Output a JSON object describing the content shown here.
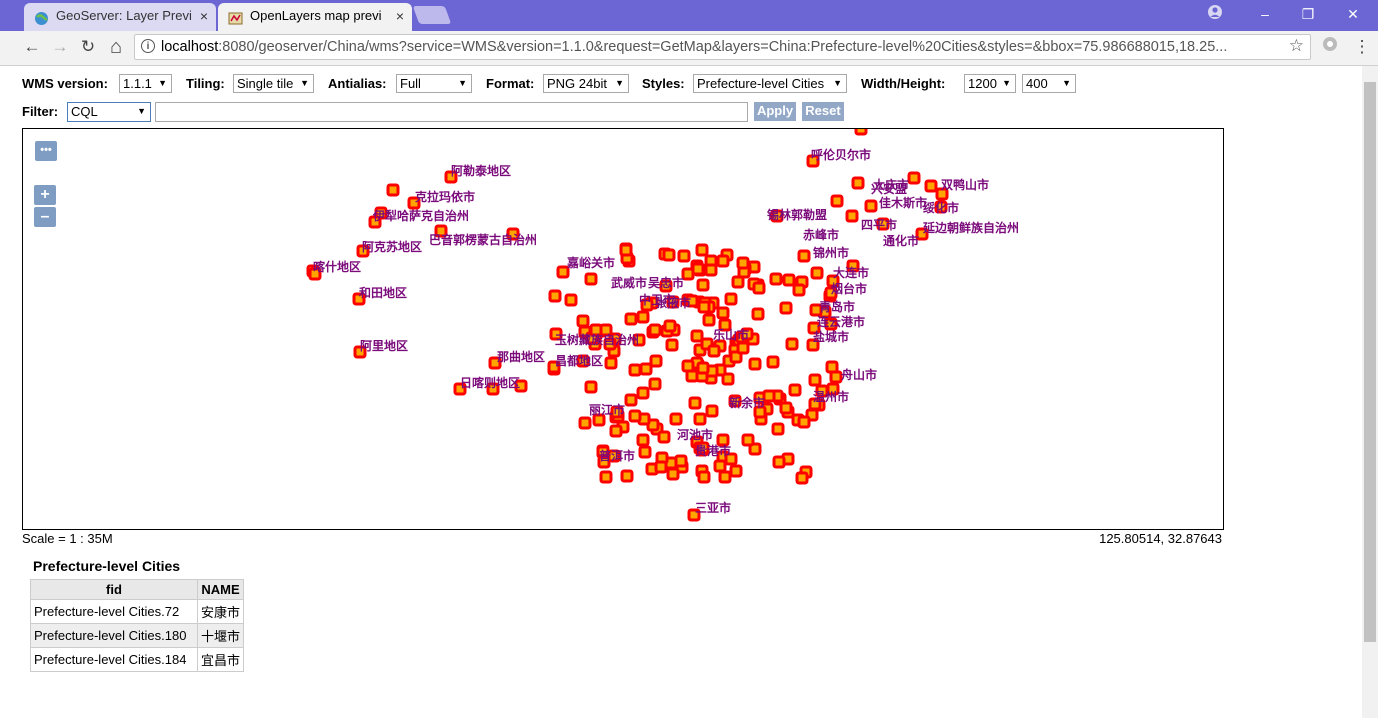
{
  "browser": {
    "tabs": [
      {
        "title": "GeoServer: Layer Previ",
        "close": "×",
        "active": false
      },
      {
        "title": "OpenLayers map previ",
        "close": "×",
        "active": true
      }
    ],
    "window_controls": {
      "minimize": "–",
      "maximize": "❐",
      "close": "✕"
    },
    "nav": {
      "back": "←",
      "forward": "→",
      "reload": "↻",
      "home": "⌂"
    },
    "url_host": "localhost",
    "url_rest": ":8080/geoserver/China/wms?service=WMS&version=1.1.0&request=GetMap&layers=China:Prefecture-level%20Cities&styles=&bbox=75.986688015,18.25...",
    "menu": "⋮"
  },
  "controls": {
    "wms_version": {
      "label": "WMS version:",
      "value": "1.1.1"
    },
    "tiling": {
      "label": "Tiling:",
      "value": "Single tile"
    },
    "antialias": {
      "label": "Antialias:",
      "value": "Full"
    },
    "format": {
      "label": "Format:",
      "value": "PNG 24bit"
    },
    "styles": {
      "label": "Styles:",
      "value": "Prefecture-level Cities"
    },
    "size": {
      "label": "Width/Height:",
      "width": "1200",
      "height": "400"
    },
    "filter": {
      "label": "Filter:",
      "type": "CQL",
      "value": "",
      "apply": "Apply",
      "reset": "Reset"
    }
  },
  "map": {
    "toggle_label": "•••",
    "zoom_in": "+",
    "zoom_out": "–",
    "point_color": "#ff0000",
    "point_fill": "#ffa500",
    "label_color": "#7b0a7b",
    "labels": [
      "阿勒泰地区",
      "克拉玛依市",
      "伊犁哈萨克自治州",
      "巴音郭楞蒙古自治州",
      "阿克苏地区",
      "喀什地区",
      "和田地区",
      "阿里地区",
      "那曲地区",
      "昌都地区",
      "日喀则地区",
      "玉树藏族自治州",
      "嘉峪关市",
      "武威市",
      "中卫市",
      "吴忠市",
      "呼伦贝尔市",
      "大庆市",
      "双鸭山市",
      "绥化市",
      "佳木斯市",
      "锡林郭勒盟",
      "四平市",
      "延边朝鲜族自治州",
      "赤峰市",
      "通化市",
      "大连市",
      "烟台市",
      "青岛市",
      "连云港市",
      "盐城市",
      "舟山市",
      "温州市",
      "三亚市",
      "普洱市",
      "河池市",
      "贵港市",
      "丽江市",
      "新余市",
      "张掖市",
      "兴安盟",
      "锦州市",
      "乐山市"
    ]
  },
  "status": {
    "scale": "Scale = 1 : 35M",
    "coords": "125.80514, 32.87643"
  },
  "feature_info": {
    "title": "Prefecture-level Cities",
    "headers": [
      "fid",
      "NAME"
    ],
    "rows": [
      [
        "Prefecture-level Cities.72",
        "安康市"
      ],
      [
        "Prefecture-level Cities.180",
        "十堰市"
      ],
      [
        "Prefecture-level Cities.184",
        "宜昌市"
      ]
    ]
  }
}
